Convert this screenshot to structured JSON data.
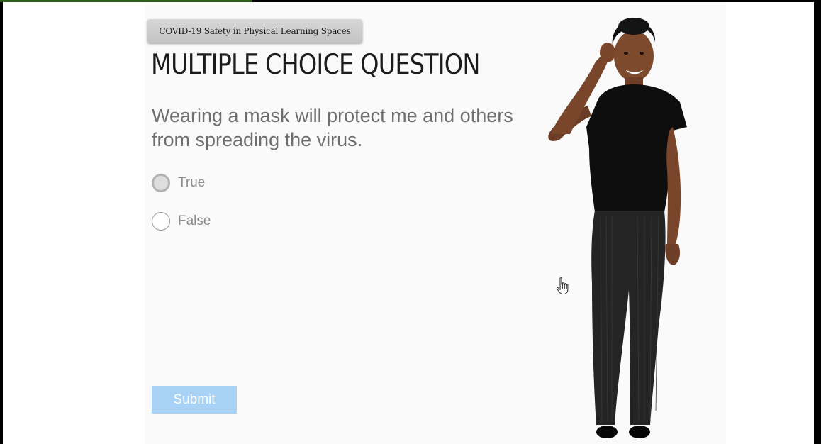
{
  "course": {
    "title": "COVID-19 Safety in Physical Learning Spaces"
  },
  "question": {
    "type_heading": "MULTIPLE CHOICE QUESTION",
    "text": "Wearing a mask will protect me and others from spreading the virus.",
    "options": [
      {
        "label": "True",
        "state": "hovered"
      },
      {
        "label": "False",
        "state": "unselected"
      }
    ],
    "submit_label": "Submit"
  },
  "colors": {
    "submit_button": "#a7d1f5",
    "heading_text": "#1c1c1c",
    "question_text": "#6e6e6e",
    "badge_background": "#cfcfcf"
  },
  "icons": {
    "cursor": "hand-pointer-icon"
  }
}
